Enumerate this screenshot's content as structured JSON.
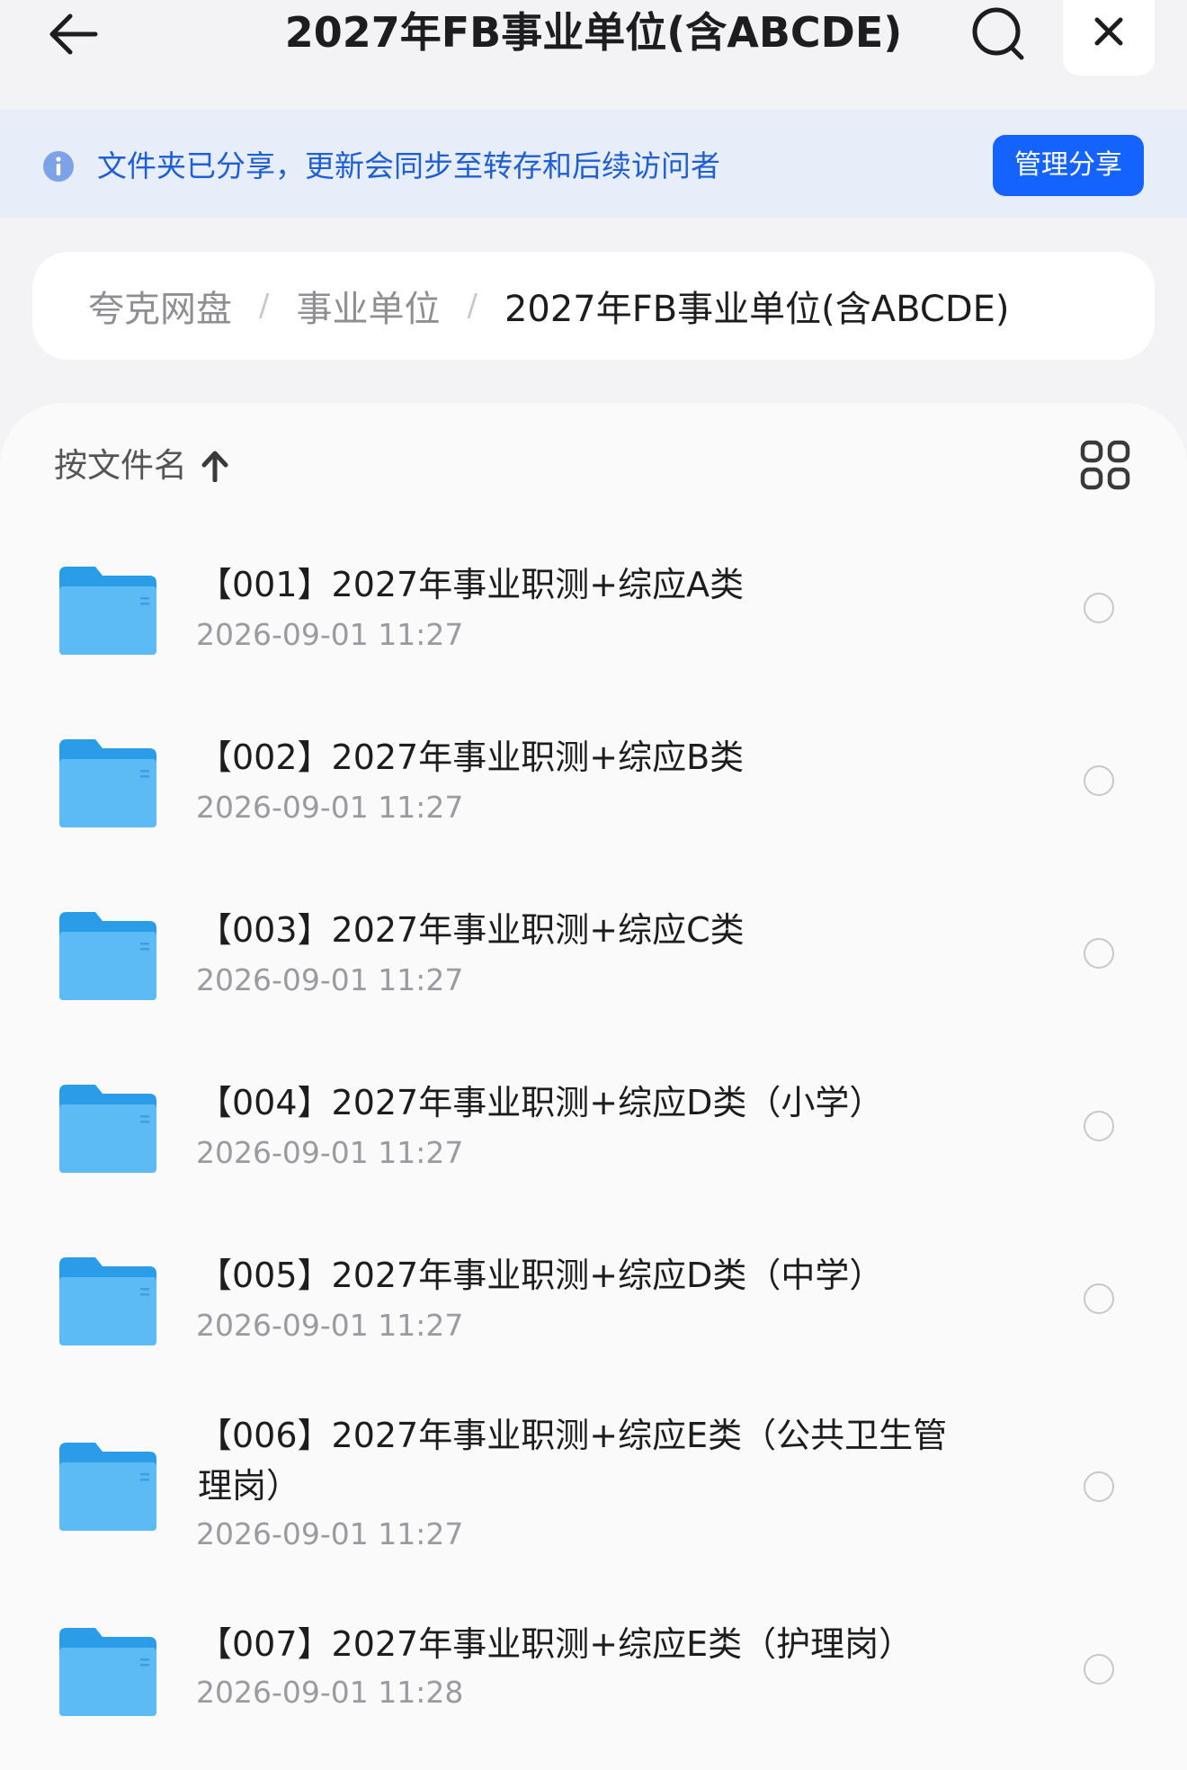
{
  "header": {
    "title": "2027年FB事业单位(含ABCDE)",
    "back_icon": "arrow-left-icon",
    "search_icon": "search-icon",
    "close_icon": "close-icon"
  },
  "banner": {
    "icon": "info-icon",
    "text": "文件夹已分享，更新会同步至转存和后续访问者",
    "button_label": "管理分享",
    "text_color": "#1f5fd6",
    "button_color": "#1463ff"
  },
  "breadcrumb": {
    "items": [
      "夸克网盘",
      "事业单位",
      "2027年FB事业单位(含ABCDE)"
    ],
    "separator": "/"
  },
  "toolbar": {
    "sort_label": "按文件名",
    "sort_icon": "arrow-up-icon",
    "view_icon": "grid-view-icon"
  },
  "files": [
    {
      "name": "【001】2027年事业职测+综应A类",
      "date": "2026-09-01 11:27"
    },
    {
      "name": "【002】2027年事业职测+综应B类",
      "date": "2026-09-01 11:27"
    },
    {
      "name": "【003】2027年事业职测+综应C类",
      "date": "2026-09-01 11:27"
    },
    {
      "name": "【004】2027年事业职测+综应D类（小学）",
      "date": "2026-09-01 11:27"
    },
    {
      "name": "【005】2027年事业职测+综应D类（中学）",
      "date": "2026-09-01 11:27"
    },
    {
      "name": "【006】2027年事业职测+综应E类（公共卫生管理岗）",
      "date": "2026-09-01 11:27"
    },
    {
      "name": "【007】2027年事业职测+综应E类（护理岗）",
      "date": "2026-09-01 11:28"
    }
  ]
}
